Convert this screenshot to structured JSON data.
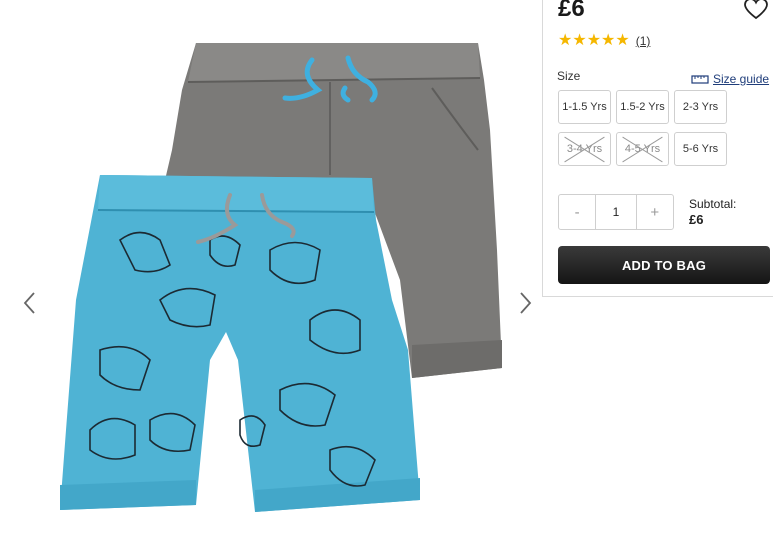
{
  "product": {
    "price": "£6",
    "rating_count": "(1)",
    "stars": 5,
    "star_color": "#f5b700"
  },
  "size": {
    "label": "Size",
    "guide_label": "Size guide",
    "options": [
      {
        "label": "1-1.5 Yrs",
        "available": true
      },
      {
        "label": "1.5-2 Yrs",
        "available": true
      },
      {
        "label": "2-3 Yrs",
        "available": true
      },
      {
        "label": "3-4 Yrs",
        "available": false
      },
      {
        "label": "4-5 Yrs",
        "available": false
      },
      {
        "label": "5-6 Yrs",
        "available": true
      }
    ]
  },
  "quantity": {
    "minus": "-",
    "value": "1",
    "plus": "+"
  },
  "subtotal": {
    "label": "Subtotal:",
    "amount": "£6"
  },
  "actions": {
    "add_to_bag": "ADD TO BAG"
  },
  "colors": {
    "grey_shorts": "#7b7a78",
    "blue_shorts": "#4fb3d4",
    "drawcord_blue": "#3fb0e0"
  }
}
